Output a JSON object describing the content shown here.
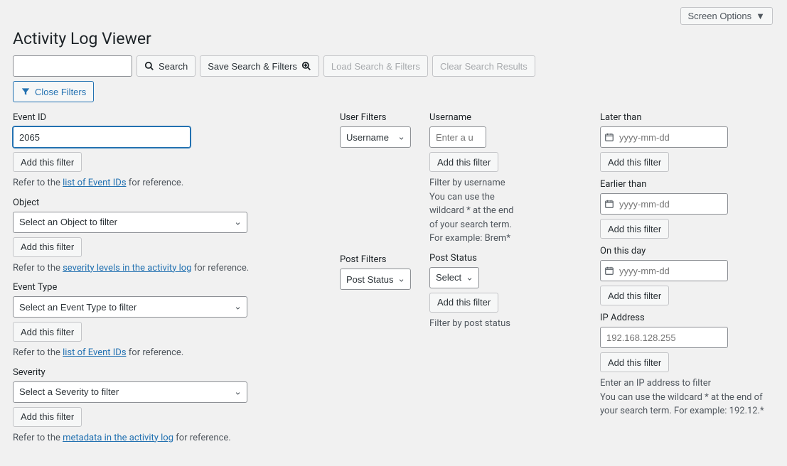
{
  "screenOptions": "Screen Options",
  "pageTitle": "Activity Log Viewer",
  "toolbar": {
    "search": "Search",
    "saveSearch": "Save Search & Filters",
    "loadSearch": "Load Search & Filters",
    "clearSearch": "Clear Search Results"
  },
  "closeFilters": "Close Filters",
  "addFilter": "Add this filter",
  "col1": {
    "eventId": {
      "label": "Event ID",
      "value": "2065",
      "hintPre": "Refer to the ",
      "hintLink": "list of Event IDs",
      "hintPost": " for reference."
    },
    "object": {
      "label": "Object",
      "placeholder": "Select an Object to filter",
      "hintPre": "Refer to the ",
      "hintLink": "severity levels in the activity log",
      "hintPost": " for reference."
    },
    "eventType": {
      "label": "Event Type",
      "placeholder": "Select an Event Type to filter",
      "hintPre": "Refer to the ",
      "hintLink": "list of Event IDs",
      "hintPost": " for reference."
    },
    "severity": {
      "label": "Severity",
      "placeholder": "Select a Severity to filter",
      "hintPre": "Refer to the ",
      "hintLink": "metadata in the activity log",
      "hintPost": " for reference."
    }
  },
  "col2": {
    "userFilters": {
      "label": "User Filters",
      "selected": "Username"
    },
    "postFilters": {
      "label": "Post Filters",
      "selected": "Post Status"
    }
  },
  "col3": {
    "username": {
      "label": "Username",
      "placeholder": "Enter a u",
      "hint": "Filter by username\nYou can use the wildcard * at the end of your search term. For example: Brem*"
    },
    "postStatus": {
      "label": "Post Status",
      "placeholder": "Select",
      "hint": "Filter by post status"
    }
  },
  "col4": {
    "later": {
      "label": "Later than",
      "placeholder": "yyyy-mm-dd"
    },
    "earlier": {
      "label": "Earlier than",
      "placeholder": "yyyy-mm-dd"
    },
    "onDay": {
      "label": "On this day",
      "placeholder": "yyyy-mm-dd"
    },
    "ip": {
      "label": "IP Address",
      "placeholder": "192.168.128.255",
      "hint": "Enter an IP address to filter\nYou can use the wildcard * at the end of your search term. For example: 192.12.*"
    }
  }
}
